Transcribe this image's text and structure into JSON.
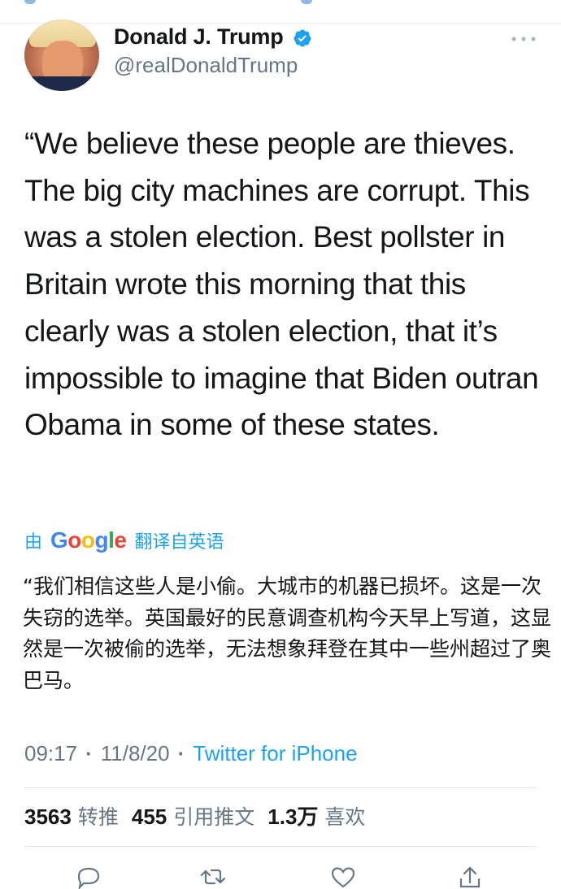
{
  "tweet": {
    "author": {
      "display_name": "Donald J. Trump",
      "handle": "@realDonaldTrump",
      "verified": true
    },
    "text": "“We believe these people are thieves. The big city machines are corrupt. This was a stolen election. Best pollster in Britain wrote this morning that this clearly was a stolen election, that it’s impossible to imagine that Biden outran Obama in some of these states.",
    "translation": {
      "prefix": "由",
      "provider": "Google",
      "suffix": "翻译自英语",
      "text": "“我们相信这些人是小偷。大城市的机器已损坏。这是一次失窃的选举。英国最好的民意调查机构今天早上写道，这显然是一次被偷的选举，无法想象拜登在其中一些州超过了奥巴马。"
    },
    "time": "09:17",
    "date": "11/8/20",
    "source": "Twitter for iPhone",
    "separator": "·",
    "stats": {
      "retweets": {
        "count": "3563",
        "label": "转推"
      },
      "quotes": {
        "count": "455",
        "label": "引用推文"
      },
      "likes": {
        "count": "1.3万",
        "label": "喜欢"
      }
    }
  },
  "colors": {
    "accent": "#1da1f2",
    "secondary_text": "#657786",
    "primary_text": "#14171a",
    "divider": "#e1e8ed"
  },
  "icons": {
    "verified": "verified-badge-icon",
    "more": "more-horizontal-icon",
    "actions": [
      "reply-icon",
      "retweet-icon",
      "like-icon",
      "share-icon"
    ]
  }
}
